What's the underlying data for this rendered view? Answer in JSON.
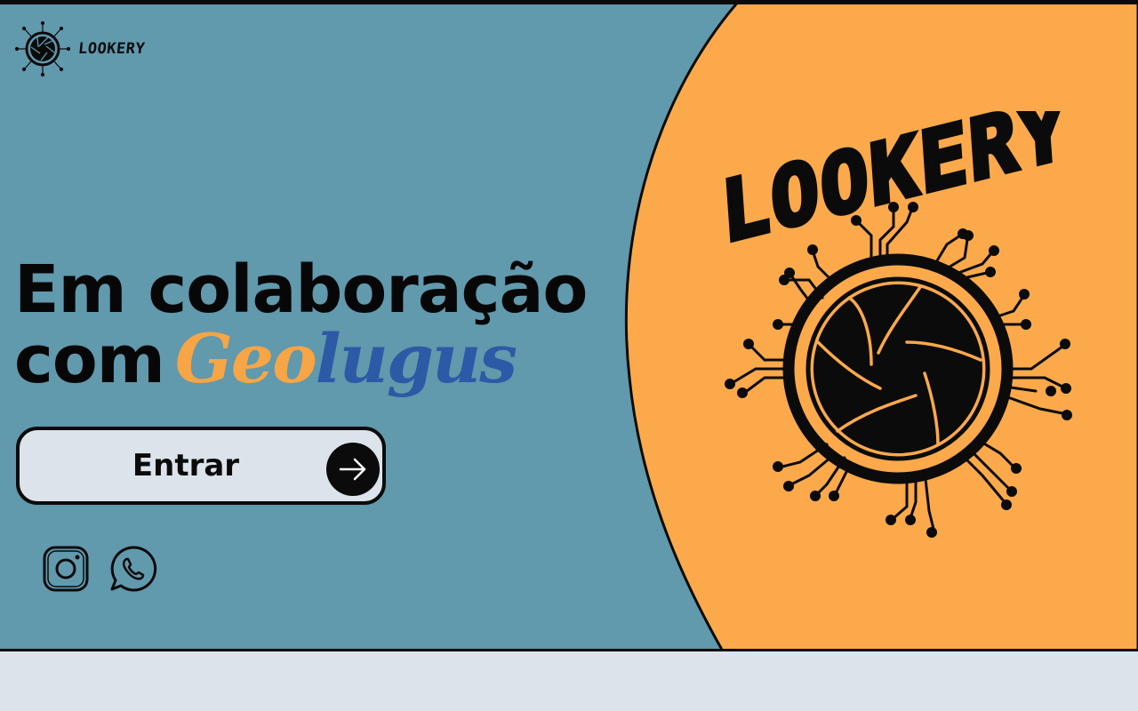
{
  "brand": {
    "name": "LOOKERY"
  },
  "hero": {
    "headline_line1": "Em colaboração",
    "headline_line2_prefix": "com",
    "partner_geo": "Geo",
    "partner_lugus": "lugus"
  },
  "cta": {
    "label": "Entrar",
    "icon": "arrow-right-icon"
  },
  "social": [
    {
      "name": "instagram-icon"
    },
    {
      "name": "whatsapp-icon"
    }
  ],
  "big_logo": {
    "text": "LOOKERY",
    "icon": "camera-aperture-icon"
  },
  "colors": {
    "blue_bg": "#6199ad",
    "orange_bg": "#fba94b",
    "bottom_bar": "#dde3ea",
    "partner_orange": "#f7a545",
    "partner_blue": "#2d5aa6",
    "ink": "#0b0b0b"
  }
}
